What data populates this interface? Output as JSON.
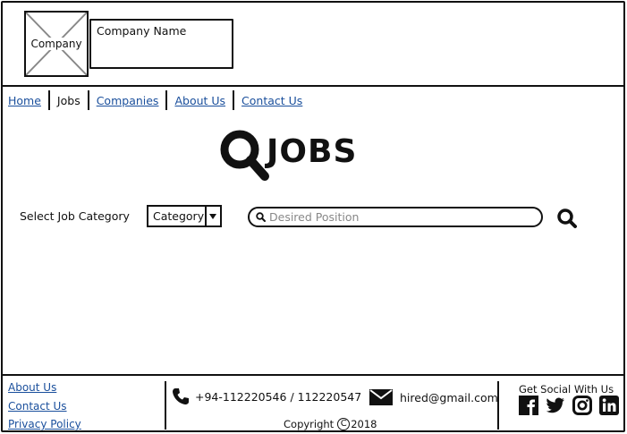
{
  "header": {
    "logo_text": "Company",
    "company_name": "Company Name"
  },
  "nav": {
    "home": "Home",
    "jobs": "Jobs",
    "companies": "Companies",
    "about": "About Us",
    "contact": "Contact Us"
  },
  "title": {
    "text": "JOBS",
    "icon": "search-icon"
  },
  "search": {
    "category_label": "Select Job Category",
    "category_selected": "Category",
    "position_placeholder": "Desired Position"
  },
  "footer": {
    "links": [
      "About Us",
      "Contact Us",
      "Privacy Policy"
    ],
    "phone": "+94-112220546 / 112220547",
    "email": "hired@gmail.com",
    "copyright_prefix": "Copyright",
    "copyright_symbol": "C",
    "copyright_year": "2018",
    "social_title": "Get Social With Us",
    "social_icons": [
      "facebook-icon",
      "twitter-icon",
      "instagram-icon",
      "linkedin-icon"
    ]
  },
  "colors": {
    "link": "#1a4f9c",
    "border": "#111111"
  }
}
